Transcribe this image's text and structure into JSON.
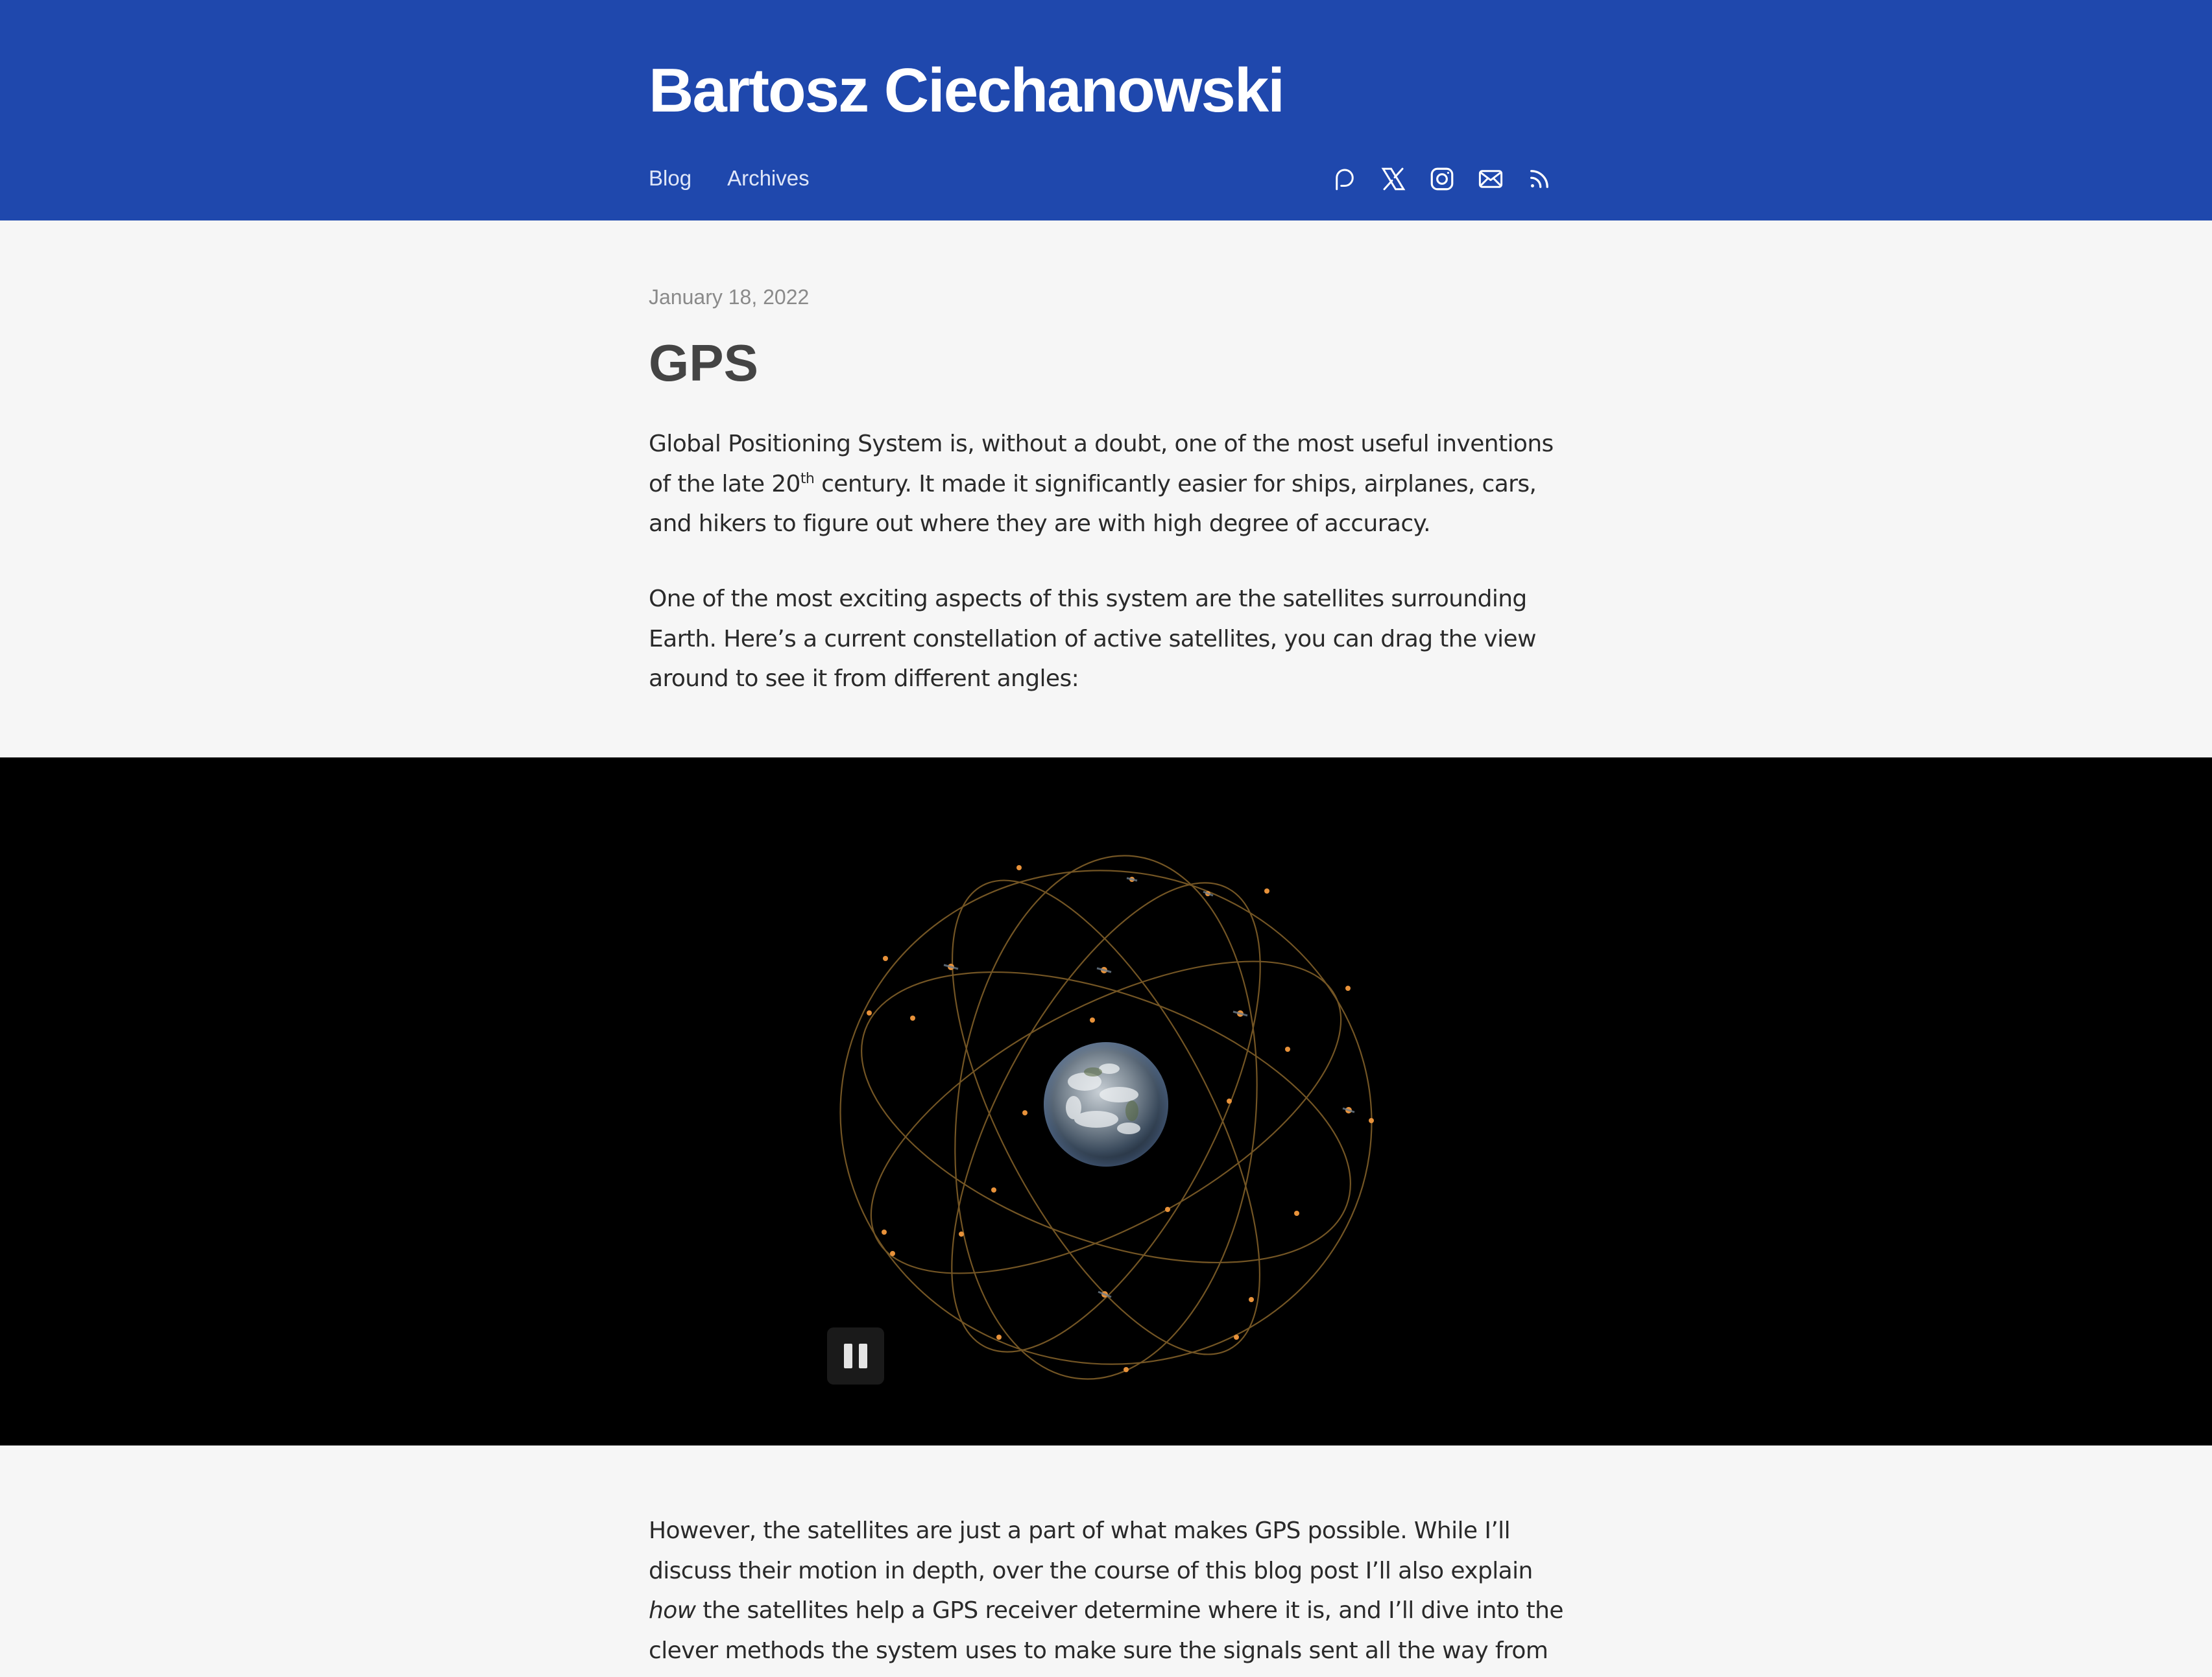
{
  "header": {
    "site_title": "Bartosz Ciechanowski",
    "nav": [
      {
        "label": "Blog"
      },
      {
        "label": "Archives"
      }
    ],
    "social_icons": [
      "patreon-icon",
      "x-icon",
      "instagram-icon",
      "mail-icon",
      "rss-icon"
    ],
    "background_color": "#1f48ad"
  },
  "post": {
    "date": "January 18, 2022",
    "title": "GPS",
    "p1": {
      "before_sup": "Global Positioning System is, without a doubt, one of the most useful inventions of the late 20",
      "sup": "th",
      "after_sup": " century. It made it significantly easier for ships, airplanes, cars, and hikers to figure out where they are with high degree of accuracy."
    },
    "p2": "One of the most exciting aspects of this system are the satellites surrounding Earth. Here’s a current constellation of active satellites, you can drag the view around to see it from different angles:",
    "p3": {
      "before_em": "However, the satellites are just a part of what makes GPS possible. While I’ll discuss their motion in depth, over the course of this blog post I’ll also explain ",
      "em": "how",
      "after_em": " the satellites help a GPS receiver determine where it is, and I’ll dive into the clever methods the system uses to make sure the signals sent all the way from"
    }
  },
  "figure": {
    "description_icon": "earth-globe",
    "orbit_color": "#8a6a2e",
    "satellite_color": "#e8923a",
    "pause_button_icon": "pause-icon"
  }
}
